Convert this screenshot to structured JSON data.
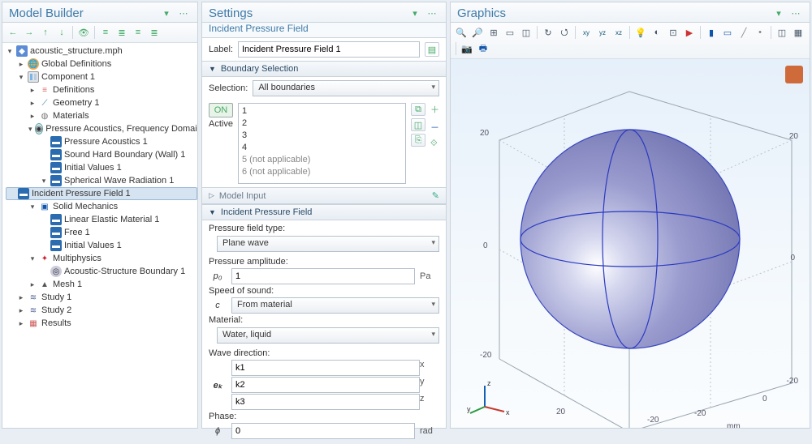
{
  "panels": {
    "model_builder": "Model Builder",
    "settings": "Settings",
    "settings_sub": "Incident Pressure Field",
    "graphics": "Graphics"
  },
  "tree": {
    "root": "acoustic_structure.mph",
    "global": "Global Definitions",
    "component": "Component 1",
    "definitions": "Definitions",
    "geometry": "Geometry 1",
    "materials": "Materials",
    "physA": "Pressure Acoustics, Frequency Domain",
    "physA1": "Pressure Acoustics 1",
    "physA2": "Sound Hard Boundary (Wall) 1",
    "physA3": "Initial Values 1",
    "physA4": "Spherical Wave Radiation 1",
    "physA4a": "Incident Pressure Field 1",
    "physB": "Solid Mechanics",
    "physB1": "Linear Elastic Material 1",
    "physB2": "Free 1",
    "physB3": "Initial Values 1",
    "multi": "Multiphysics",
    "multi1": "Acoustic-Structure Boundary 1",
    "mesh": "Mesh 1",
    "study1": "Study 1",
    "study2": "Study 2",
    "results": "Results"
  },
  "settingsForm": {
    "labelLabel": "Label:",
    "labelValue": "Incident Pressure Field 1",
    "sec_boundary": "Boundary Selection",
    "selectionLabel": "Selection:",
    "selectionValue": "All boundaries",
    "activeLabel": "Active",
    "bnd": [
      "1",
      "2",
      "3",
      "4",
      "5 (not applicable)",
      "6 (not applicable)"
    ],
    "sec_modelinput": "Model Input",
    "sec_ipf": "Incident Pressure Field",
    "pftypeLabel": "Pressure field type:",
    "pftypeValue": "Plane wave",
    "pampLabel": "Pressure amplitude:",
    "pampSym": "p₀",
    "pampVal": "1",
    "pampUnit": "Pa",
    "sosLabel": "Speed of sound:",
    "sosSym": "c",
    "sosVal": "From material",
    "matLabel": "Material:",
    "matVal": "Water, liquid",
    "wdirLabel": "Wave direction:",
    "wdirSym": "eₖ",
    "k1": {
      "v": "k1",
      "a": "x"
    },
    "k2": {
      "v": "k2",
      "a": "y"
    },
    "k3": {
      "v": "k3",
      "a": "z"
    },
    "phaseLabel": "Phase:",
    "phaseSym": "ϕ",
    "phaseVal": "0",
    "phaseUnit": "rad"
  },
  "graphics": {
    "ticks": [
      "-20",
      "0",
      "20"
    ],
    "unit": "mm",
    "axes": {
      "x": "x",
      "y": "y",
      "z": "z"
    }
  }
}
